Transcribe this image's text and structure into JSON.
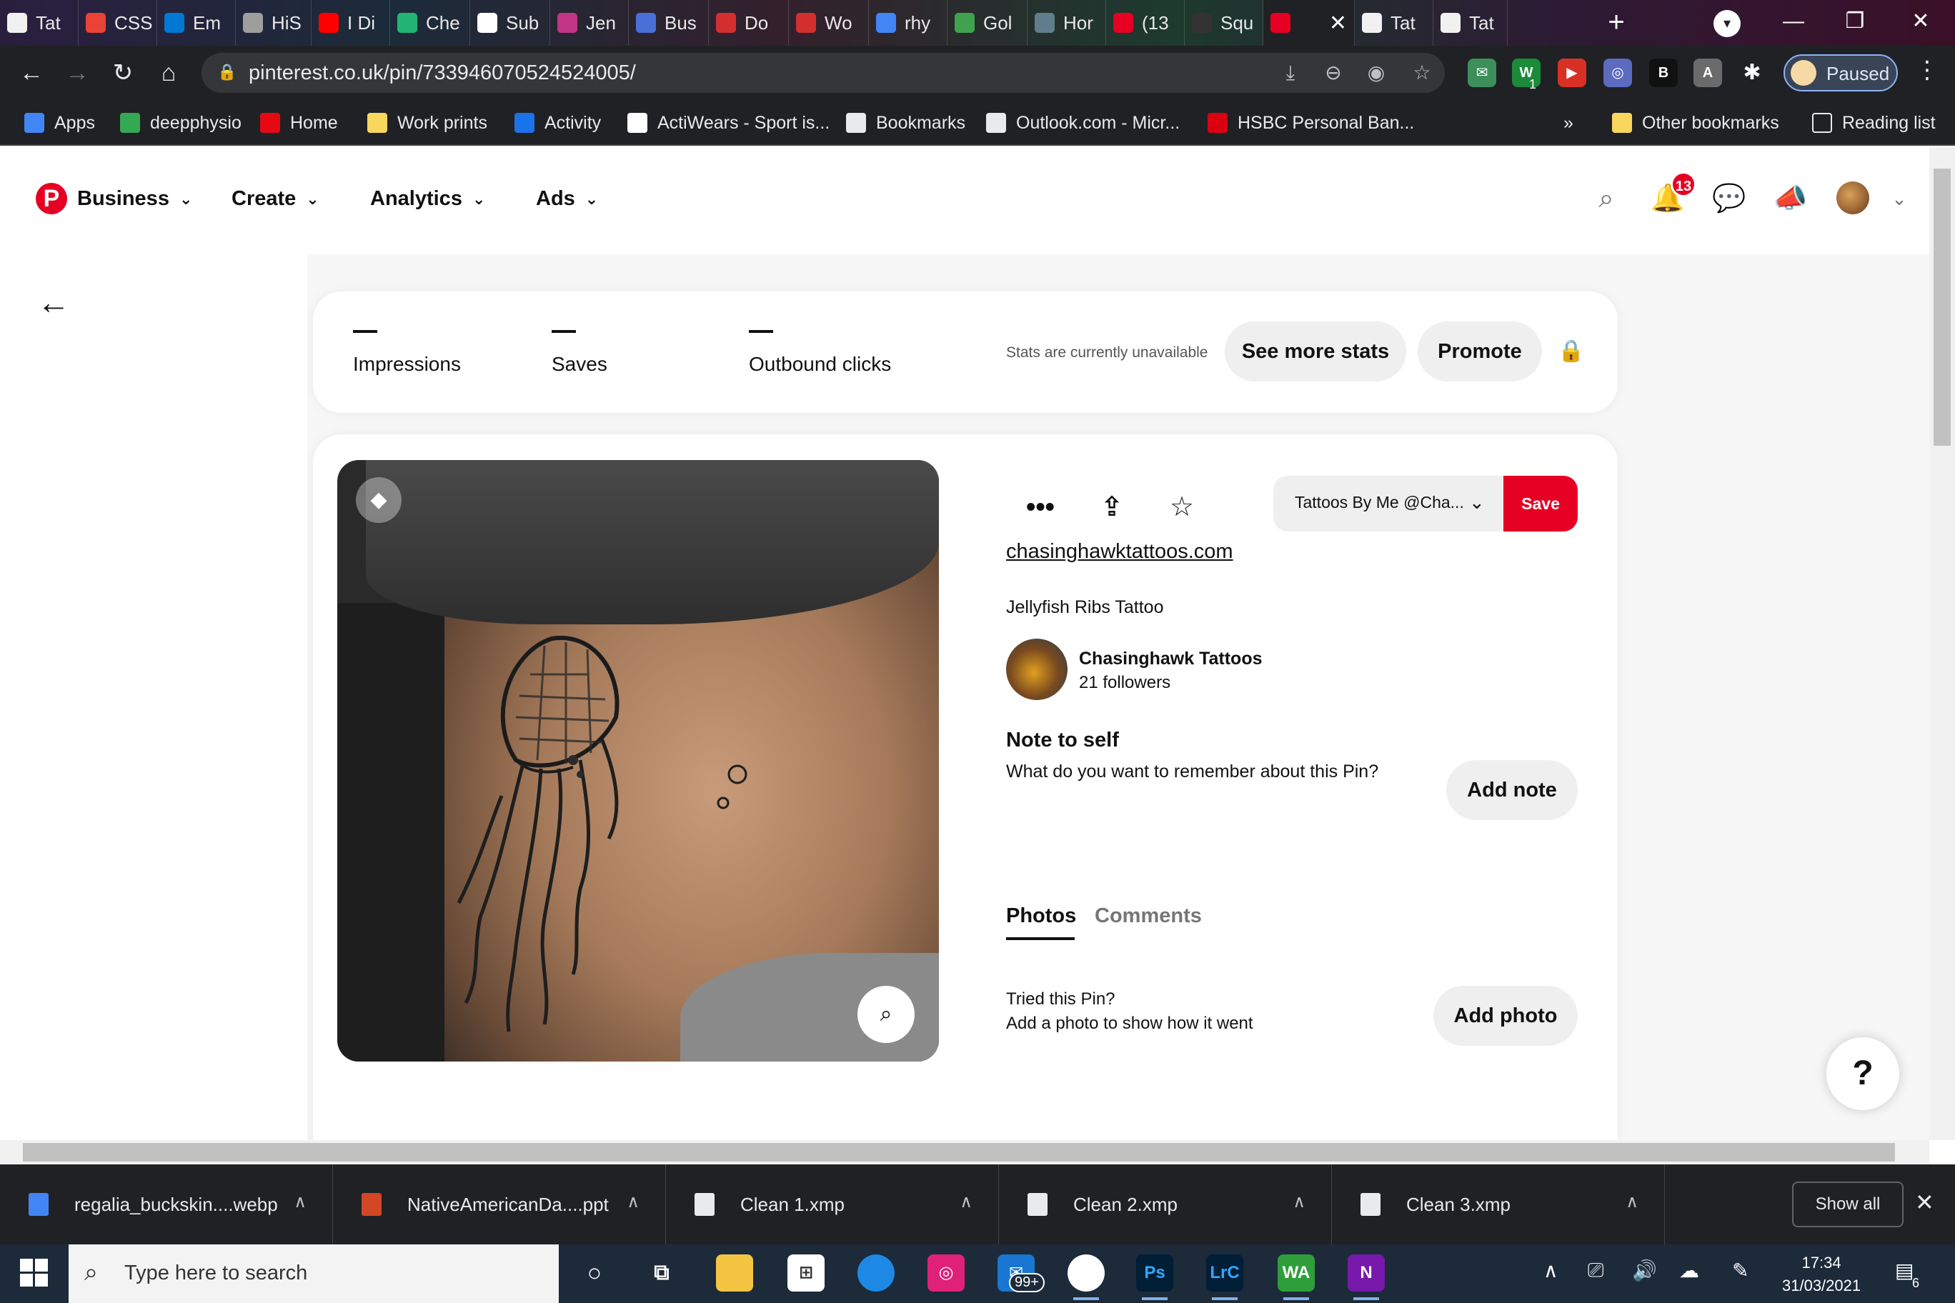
{
  "browser": {
    "tabs": [
      {
        "title": "Tat",
        "color": "#f1f1f1"
      },
      {
        "title": "CSS",
        "color": "#ea4335"
      },
      {
        "title": "Em",
        "color": "#0078d4"
      },
      {
        "title": "HiS",
        "color": "#9e9e9e"
      },
      {
        "title": "I Di",
        "color": "#ff0000"
      },
      {
        "title": "Che",
        "color": "#22b573"
      },
      {
        "title": "Sub",
        "color": "#ffffff"
      },
      {
        "title": "Jen",
        "color": "#c13584"
      },
      {
        "title": "Bus",
        "color": "#4a6fd6"
      },
      {
        "title": "Do",
        "color": "#d32f2f"
      },
      {
        "title": "Wo",
        "color": "#d32f2f"
      },
      {
        "title": "rhy",
        "color": "#4285f4"
      },
      {
        "title": "Gol",
        "color": "#3fa34d"
      },
      {
        "title": "Hor",
        "color": "#607d8b"
      },
      {
        "title": "(13",
        "color": "#e60023"
      },
      {
        "title": "Squ",
        "color": "#333333"
      },
      {
        "title": "",
        "color": "#e60023"
      },
      {
        "title": "Tat",
        "color": "#f1f1f1"
      },
      {
        "title": "Tat",
        "color": "#f1f1f1"
      }
    ],
    "active_tab_index": 16,
    "new_tab_label": "+",
    "url": "pinterest.co.uk/pin/733946070524524005/",
    "profile_label": "Paused",
    "extension_badge": "1",
    "extension_letter": "B",
    "bookmarks": [
      {
        "label": "Apps",
        "color": "#4285f4"
      },
      {
        "label": "deepphysio",
        "color": "#34a853"
      },
      {
        "label": "Home",
        "color": "#e50914"
      },
      {
        "label": "Work prints",
        "color": "#f9d65c"
      },
      {
        "label": "Activity",
        "color": "#1a73e8"
      },
      {
        "label": "ActiWears - Sport is...",
        "color": "#ffffff"
      },
      {
        "label": "Bookmarks",
        "color": "#e8eaed"
      },
      {
        "label": "Outlook.com - Micr...",
        "color": "#e8eaed"
      },
      {
        "label": "HSBC Personal Ban...",
        "color": "#db0011"
      }
    ],
    "bookmarks_overflow": "»",
    "other_bookmarks": "Other bookmarks",
    "reading_list": "Reading list"
  },
  "pinterest": {
    "brand_color": "#e60023",
    "nav": [
      "Business",
      "Create",
      "Analytics",
      "Ads"
    ],
    "notification_count": "13",
    "stats": {
      "items": [
        "Impressions",
        "Saves",
        "Outbound clicks"
      ],
      "unavailable_text": "Stats are currently unavailable",
      "see_more_label": "See more stats",
      "promote_label": "Promote"
    },
    "pin": {
      "board_name": "Tattoos By Me @Cha...",
      "save_label": "Save",
      "link_text": "chasinghawktattoos.com",
      "title": "Jellyfish Ribs Tattoo",
      "creator_name": "Chasinghawk Tattoos",
      "creator_followers": "21 followers",
      "note_heading": "Note to self",
      "note_prompt": "What do you want to remember about this Pin?",
      "add_note_label": "Add note",
      "tabs": [
        "Photos",
        "Comments"
      ],
      "tried_line1": "Tried this Pin?",
      "tried_line2": "Add a photo to show how it went",
      "add_photo_label": "Add photo"
    },
    "help_label": "?"
  },
  "downloads": {
    "items": [
      {
        "name": "regalia_buckskin....webp",
        "color": "#4285f4"
      },
      {
        "name": "NativeAmericanDa....ppt",
        "color": "#d24726"
      },
      {
        "name": "Clean 1.xmp",
        "color": "#e8eaed"
      },
      {
        "name": "Clean 2.xmp",
        "color": "#e8eaed"
      },
      {
        "name": "Clean 3.xmp",
        "color": "#e8eaed"
      }
    ],
    "show_all_label": "Show all"
  },
  "taskbar": {
    "search_placeholder": "Type here to search",
    "mail_badge": "99+",
    "apps": [
      {
        "name": "Ps",
        "color": "#001e36",
        "fg": "#31a8ff"
      },
      {
        "name": "LrC",
        "color": "#001e36",
        "fg": "#31a8ff"
      },
      {
        "name": "WA",
        "color": "#2e9e3a",
        "fg": "#ffffff"
      },
      {
        "name": "N",
        "color": "#7719aa",
        "fg": "#ffffff"
      }
    ],
    "time": "17:34",
    "date": "31/03/2021",
    "notification_count": "6"
  }
}
